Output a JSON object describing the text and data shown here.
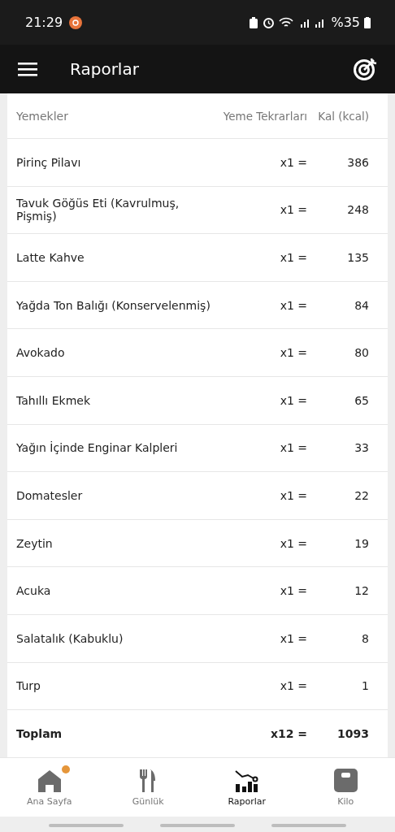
{
  "status_bar": {
    "time": "21:29",
    "battery": "%35"
  },
  "app_bar": {
    "title": "Raporlar"
  },
  "table": {
    "columns": [
      "Yemekler",
      "Yeme Tekrarları",
      "Kal (kcal)"
    ],
    "rows": [
      {
        "name": "Pirinç Pilavı",
        "times": "x1 =",
        "kcal": "386"
      },
      {
        "name": "Tavuk Göğüs Eti (Kavrulmuş, Pişmiş)",
        "times": "x1 =",
        "kcal": "248"
      },
      {
        "name": "Latte Kahve",
        "times": "x1 =",
        "kcal": "135"
      },
      {
        "name": "Yağda Ton Balığı (Konservelenmiş)",
        "times": "x1 =",
        "kcal": "84"
      },
      {
        "name": "Avokado",
        "times": "x1 =",
        "kcal": "80"
      },
      {
        "name": "Tahıllı Ekmek",
        "times": "x1 =",
        "kcal": "65"
      },
      {
        "name": "Yağın İçinde Enginar Kalpleri",
        "times": "x1 =",
        "kcal": "33"
      },
      {
        "name": "Domatesler",
        "times": "x1 =",
        "kcal": "22"
      },
      {
        "name": "Zeytin",
        "times": "x1 =",
        "kcal": "19"
      },
      {
        "name": "Acuka",
        "times": "x1 =",
        "kcal": "12"
      },
      {
        "name": "Salatalık (Kabuklu)",
        "times": "x1 =",
        "kcal": "8"
      },
      {
        "name": "Turp",
        "times": "x1 =",
        "kcal": "1"
      }
    ],
    "total": {
      "name": "Toplam",
      "times": "x12 =",
      "kcal": "1093"
    }
  },
  "bottom_nav": [
    {
      "label": "Ana Sayfa",
      "kind": "home",
      "selected": false,
      "badge": true
    },
    {
      "label": "Günlük",
      "kind": "diary",
      "selected": false,
      "badge": false
    },
    {
      "label": "Raporlar",
      "kind": "reports",
      "selected": true,
      "badge": false
    },
    {
      "label": "Kilo",
      "kind": "weight",
      "selected": false,
      "badge": false
    }
  ]
}
